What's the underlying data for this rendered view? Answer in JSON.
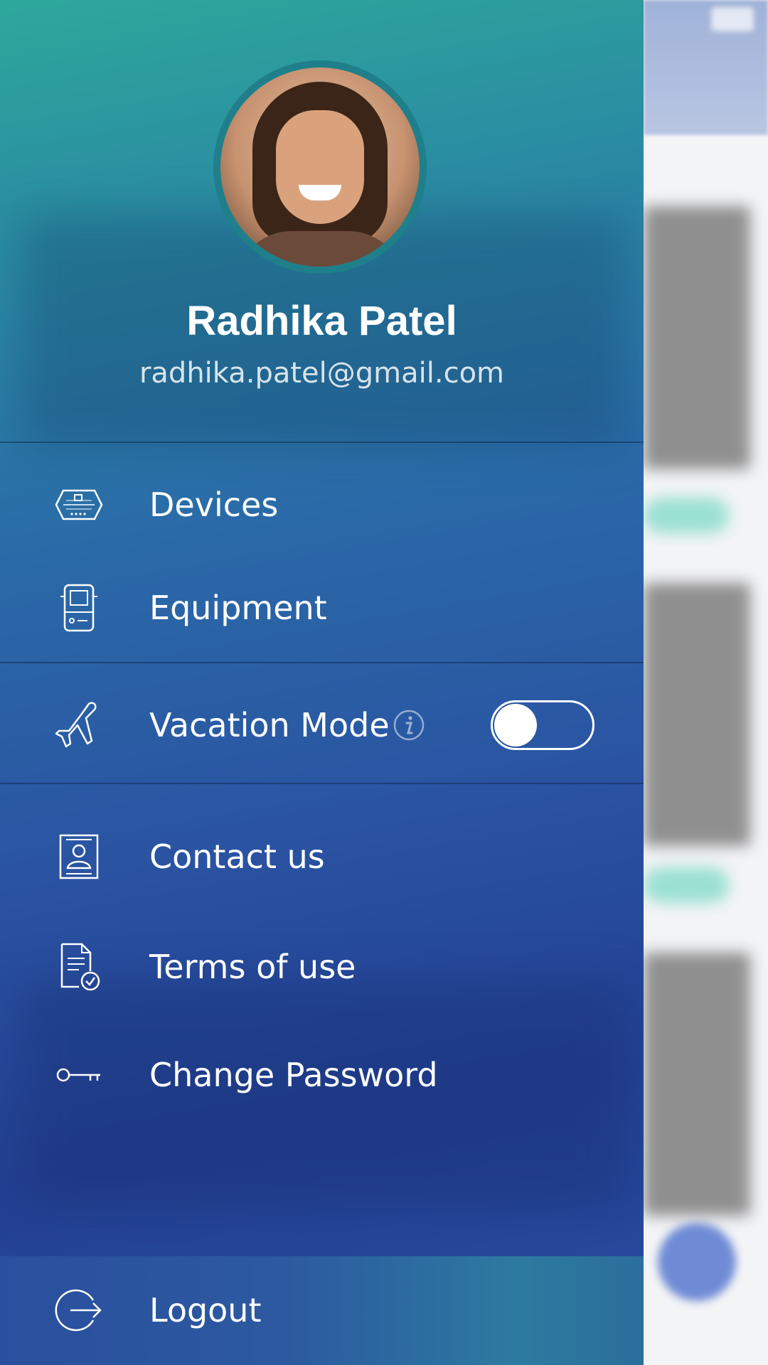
{
  "profile": {
    "name": "Radhika Patel",
    "email": "radhika.patel@gmail.com"
  },
  "menu": {
    "devices": {
      "label": "Devices",
      "icon": "devices-icon"
    },
    "equipment": {
      "label": "Equipment",
      "icon": "equipment-icon"
    },
    "vacation": {
      "label": "Vacation Mode",
      "icon": "airplane-icon",
      "enabled": false
    },
    "contact": {
      "label": "Contact us",
      "icon": "contact-icon"
    },
    "terms": {
      "label": "Terms of use",
      "icon": "document-check-icon"
    },
    "password": {
      "label": "Change Password",
      "icon": "key-icon"
    },
    "logout": {
      "label": "Logout",
      "icon": "logout-icon"
    }
  },
  "colors": {
    "drawer_top": "#2da79b",
    "drawer_bottom": "#233f92",
    "text": "#ffffff",
    "avatar_ring": "#1f7f8a"
  }
}
